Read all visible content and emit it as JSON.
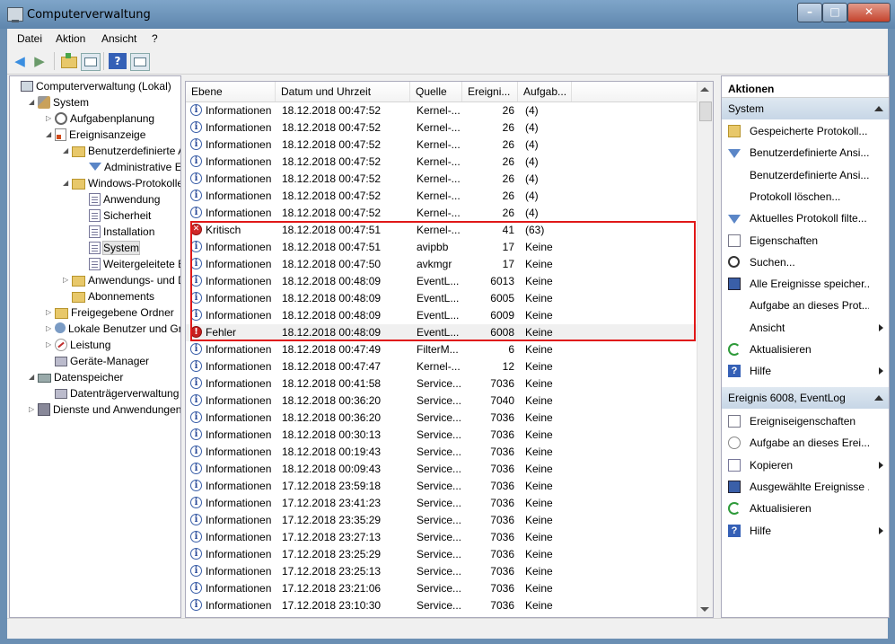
{
  "window": {
    "title": "Computerverwaltung"
  },
  "menu": {
    "items": [
      "Datei",
      "Aktion",
      "Ansicht",
      "?"
    ]
  },
  "tree": [
    {
      "label": "Computerverwaltung (Lokal)",
      "icon": "computer-icon",
      "level": 0,
      "expander": ""
    },
    {
      "label": "System",
      "icon": "tools-icon",
      "level": 1,
      "expander": "◢"
    },
    {
      "label": "Aufgabenplanung",
      "icon": "clock-icon",
      "level": 2,
      "expander": "▷"
    },
    {
      "label": "Ereignisanzeige",
      "icon": "event-viewer-icon",
      "level": 2,
      "expander": "◢"
    },
    {
      "label": "Benutzerdefinierte A",
      "icon": "folder-icon",
      "level": 3,
      "expander": "◢"
    },
    {
      "label": "Administrative E",
      "icon": "filter-icon",
      "level": 4,
      "expander": ""
    },
    {
      "label": "Windows-Protokolle",
      "icon": "folder-icon",
      "level": 3,
      "expander": "◢"
    },
    {
      "label": "Anwendung",
      "icon": "log-icon",
      "level": 4,
      "expander": ""
    },
    {
      "label": "Sicherheit",
      "icon": "log-icon",
      "level": 4,
      "expander": ""
    },
    {
      "label": "Installation",
      "icon": "log-icon",
      "level": 4,
      "expander": ""
    },
    {
      "label": "System",
      "icon": "log-icon",
      "level": 4,
      "expander": "",
      "selected": true
    },
    {
      "label": "Weitergeleitete E",
      "icon": "log-icon",
      "level": 4,
      "expander": ""
    },
    {
      "label": "Anwendungs- und D",
      "icon": "folder-icon",
      "level": 3,
      "expander": "▷"
    },
    {
      "label": "Abonnements",
      "icon": "folder-icon",
      "level": 3,
      "expander": ""
    },
    {
      "label": "Freigegebene Ordner",
      "icon": "shared-folder-icon",
      "level": 2,
      "expander": "▷"
    },
    {
      "label": "Lokale Benutzer und Gr",
      "icon": "users-icon",
      "level": 2,
      "expander": "▷"
    },
    {
      "label": "Leistung",
      "icon": "performance-icon",
      "level": 2,
      "expander": "▷"
    },
    {
      "label": "Geräte-Manager",
      "icon": "device-manager-icon",
      "level": 2,
      "expander": ""
    },
    {
      "label": "Datenspeicher",
      "icon": "storage-icon",
      "level": 1,
      "expander": "◢"
    },
    {
      "label": "Datenträgerverwaltung",
      "icon": "disk-icon",
      "level": 2,
      "expander": ""
    },
    {
      "label": "Dienste und Anwendungen",
      "icon": "services-icon",
      "level": 1,
      "expander": "▷"
    }
  ],
  "events": {
    "columns": [
      "Ebene",
      "Datum und Uhrzeit",
      "Quelle",
      "Ereigni...",
      "Aufgab..."
    ],
    "rows": [
      {
        "level": "Informationen",
        "type": "info",
        "date": "18.12.2018 00:47:52",
        "source": "Kernel-...",
        "id": "26",
        "task": "(4)"
      },
      {
        "level": "Informationen",
        "type": "info",
        "date": "18.12.2018 00:47:52",
        "source": "Kernel-...",
        "id": "26",
        "task": "(4)"
      },
      {
        "level": "Informationen",
        "type": "info",
        "date": "18.12.2018 00:47:52",
        "source": "Kernel-...",
        "id": "26",
        "task": "(4)"
      },
      {
        "level": "Informationen",
        "type": "info",
        "date": "18.12.2018 00:47:52",
        "source": "Kernel-...",
        "id": "26",
        "task": "(4)"
      },
      {
        "level": "Informationen",
        "type": "info",
        "date": "18.12.2018 00:47:52",
        "source": "Kernel-...",
        "id": "26",
        "task": "(4)"
      },
      {
        "level": "Informationen",
        "type": "info",
        "date": "18.12.2018 00:47:52",
        "source": "Kernel-...",
        "id": "26",
        "task": "(4)"
      },
      {
        "level": "Informationen",
        "type": "info",
        "date": "18.12.2018 00:47:52",
        "source": "Kernel-...",
        "id": "26",
        "task": "(4)"
      },
      {
        "level": "Kritisch",
        "type": "critical",
        "date": "18.12.2018 00:47:51",
        "source": "Kernel-...",
        "id": "41",
        "task": "(63)"
      },
      {
        "level": "Informationen",
        "type": "info",
        "date": "18.12.2018 00:47:51",
        "source": "avipbb",
        "id": "17",
        "task": "Keine"
      },
      {
        "level": "Informationen",
        "type": "info",
        "date": "18.12.2018 00:47:50",
        "source": "avkmgr",
        "id": "17",
        "task": "Keine"
      },
      {
        "level": "Informationen",
        "type": "info",
        "date": "18.12.2018 00:48:09",
        "source": "EventL...",
        "id": "6013",
        "task": "Keine"
      },
      {
        "level": "Informationen",
        "type": "info",
        "date": "18.12.2018 00:48:09",
        "source": "EventL...",
        "id": "6005",
        "task": "Keine"
      },
      {
        "level": "Informationen",
        "type": "info",
        "date": "18.12.2018 00:48:09",
        "source": "EventL...",
        "id": "6009",
        "task": "Keine"
      },
      {
        "level": "Fehler",
        "type": "error",
        "date": "18.12.2018 00:48:09",
        "source": "EventL...",
        "id": "6008",
        "task": "Keine",
        "selected": true
      },
      {
        "level": "Informationen",
        "type": "info",
        "date": "18.12.2018 00:47:49",
        "source": "FilterM...",
        "id": "6",
        "task": "Keine"
      },
      {
        "level": "Informationen",
        "type": "info",
        "date": "18.12.2018 00:47:47",
        "source": "Kernel-...",
        "id": "12",
        "task": "Keine"
      },
      {
        "level": "Informationen",
        "type": "info",
        "date": "18.12.2018 00:41:58",
        "source": "Service...",
        "id": "7036",
        "task": "Keine"
      },
      {
        "level": "Informationen",
        "type": "info",
        "date": "18.12.2018 00:36:20",
        "source": "Service...",
        "id": "7040",
        "task": "Keine"
      },
      {
        "level": "Informationen",
        "type": "info",
        "date": "18.12.2018 00:36:20",
        "source": "Service...",
        "id": "7036",
        "task": "Keine"
      },
      {
        "level": "Informationen",
        "type": "info",
        "date": "18.12.2018 00:30:13",
        "source": "Service...",
        "id": "7036",
        "task": "Keine"
      },
      {
        "level": "Informationen",
        "type": "info",
        "date": "18.12.2018 00:19:43",
        "source": "Service...",
        "id": "7036",
        "task": "Keine"
      },
      {
        "level": "Informationen",
        "type": "info",
        "date": "18.12.2018 00:09:43",
        "source": "Service...",
        "id": "7036",
        "task": "Keine"
      },
      {
        "level": "Informationen",
        "type": "info",
        "date": "17.12.2018 23:59:18",
        "source": "Service...",
        "id": "7036",
        "task": "Keine"
      },
      {
        "level": "Informationen",
        "type": "info",
        "date": "17.12.2018 23:41:23",
        "source": "Service...",
        "id": "7036",
        "task": "Keine"
      },
      {
        "level": "Informationen",
        "type": "info",
        "date": "17.12.2018 23:35:29",
        "source": "Service...",
        "id": "7036",
        "task": "Keine"
      },
      {
        "level": "Informationen",
        "type": "info",
        "date": "17.12.2018 23:27:13",
        "source": "Service...",
        "id": "7036",
        "task": "Keine"
      },
      {
        "level": "Informationen",
        "type": "info",
        "date": "17.12.2018 23:25:29",
        "source": "Service...",
        "id": "7036",
        "task": "Keine"
      },
      {
        "level": "Informationen",
        "type": "info",
        "date": "17.12.2018 23:25:13",
        "source": "Service...",
        "id": "7036",
        "task": "Keine"
      },
      {
        "level": "Informationen",
        "type": "info",
        "date": "17.12.2018 23:21:06",
        "source": "Service...",
        "id": "7036",
        "task": "Keine"
      },
      {
        "level": "Informationen",
        "type": "info",
        "date": "17.12.2018 23:10:30",
        "source": "Service...",
        "id": "7036",
        "task": "Keine"
      }
    ]
  },
  "actions": {
    "title": "Aktionen",
    "section1": "System",
    "items1": [
      {
        "label": "Gespeicherte Protokoll...",
        "icon": "open-log-icon",
        "submenu": false
      },
      {
        "label": "Benutzerdefinierte Ansi...",
        "icon": "filter-icon",
        "submenu": false
      },
      {
        "label": "Benutzerdefinierte Ansi...",
        "icon": "",
        "submenu": false
      },
      {
        "label": "Protokoll löschen...",
        "icon": "",
        "submenu": false
      },
      {
        "label": "Aktuelles Protokoll filte...",
        "icon": "filter-icon",
        "submenu": false
      },
      {
        "label": "Eigenschaften",
        "icon": "properties-icon",
        "submenu": false
      },
      {
        "label": "Suchen...",
        "icon": "find-icon",
        "submenu": false
      },
      {
        "label": "Alle Ereignisse speicher...",
        "icon": "save-icon",
        "submenu": false
      },
      {
        "label": "Aufgabe an dieses Prot...",
        "icon": "",
        "submenu": false
      },
      {
        "label": "Ansicht",
        "icon": "",
        "submenu": true
      },
      {
        "label": "Aktualisieren",
        "icon": "refresh-icon",
        "submenu": false
      },
      {
        "label": "Hilfe",
        "icon": "help-icon",
        "submenu": true
      }
    ],
    "section2": "Ereignis 6008, EventLog",
    "items2": [
      {
        "label": "Ereigniseigenschaften",
        "icon": "properties-icon",
        "submenu": false
      },
      {
        "label": "Aufgabe an dieses Erei...",
        "icon": "task-icon",
        "submenu": false
      },
      {
        "label": "Kopieren",
        "icon": "copy-icon",
        "submenu": true
      },
      {
        "label": "Ausgewählte Ereignisse ...",
        "icon": "save-icon",
        "submenu": false
      },
      {
        "label": "Aktualisieren",
        "icon": "refresh-icon",
        "submenu": false
      },
      {
        "label": "Hilfe",
        "icon": "help-icon",
        "submenu": true
      }
    ]
  },
  "colors": {
    "highlight_box": "#e01818",
    "titlebar": "#6b8fb3"
  }
}
